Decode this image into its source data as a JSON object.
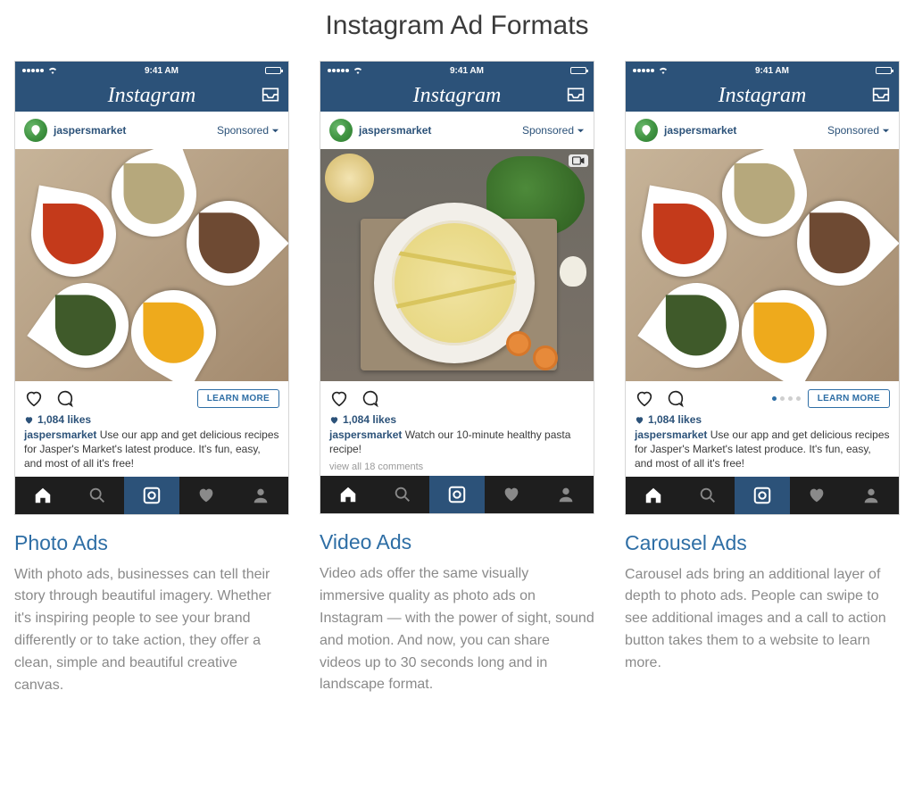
{
  "page_title": "Instagram Ad Formats",
  "status_time": "9:41 AM",
  "app_logo_text": "Instagram",
  "username": "jaspersmarket",
  "sponsored_label": "Sponsored",
  "likes_text": "1,084 likes",
  "cta_label": "LEARN MORE",
  "view_comments": "view all 18 comments",
  "ads": [
    {
      "title": "Photo Ads",
      "caption": "Use our app and get delicious recipes for Jasper's Market's latest produce. It's fun, easy, and most of all it's free!",
      "description": "With photo ads, businesses can tell their story through beautiful imagery. Whether it's inspiring people to see your brand differently or to take action, they offer a clean, simple and beautiful creative canvas.",
      "has_cta": true,
      "has_pager": false,
      "media": "spices",
      "show_view_comments": false
    },
    {
      "title": "Video Ads",
      "caption": "Watch our 10-minute healthy pasta recipe!",
      "description": "Video ads offer the same visually immersive quality as photo ads on Instagram — with the power of sight, sound and motion. And now, you can share videos up to 30 seconds long and in landscape format.",
      "has_cta": false,
      "has_pager": false,
      "media": "pasta",
      "show_view_comments": true
    },
    {
      "title": "Carousel Ads",
      "caption": "Use our app and get delicious recipes for Jasper's Market's latest produce. It's fun, easy, and most of all it's free!",
      "description": "Carousel ads bring an additional layer of depth to photo ads. People can swipe to see additional images and a call to action button takes them to a website to learn more.",
      "has_cta": true,
      "has_pager": true,
      "media": "spices",
      "show_view_comments": false
    }
  ]
}
